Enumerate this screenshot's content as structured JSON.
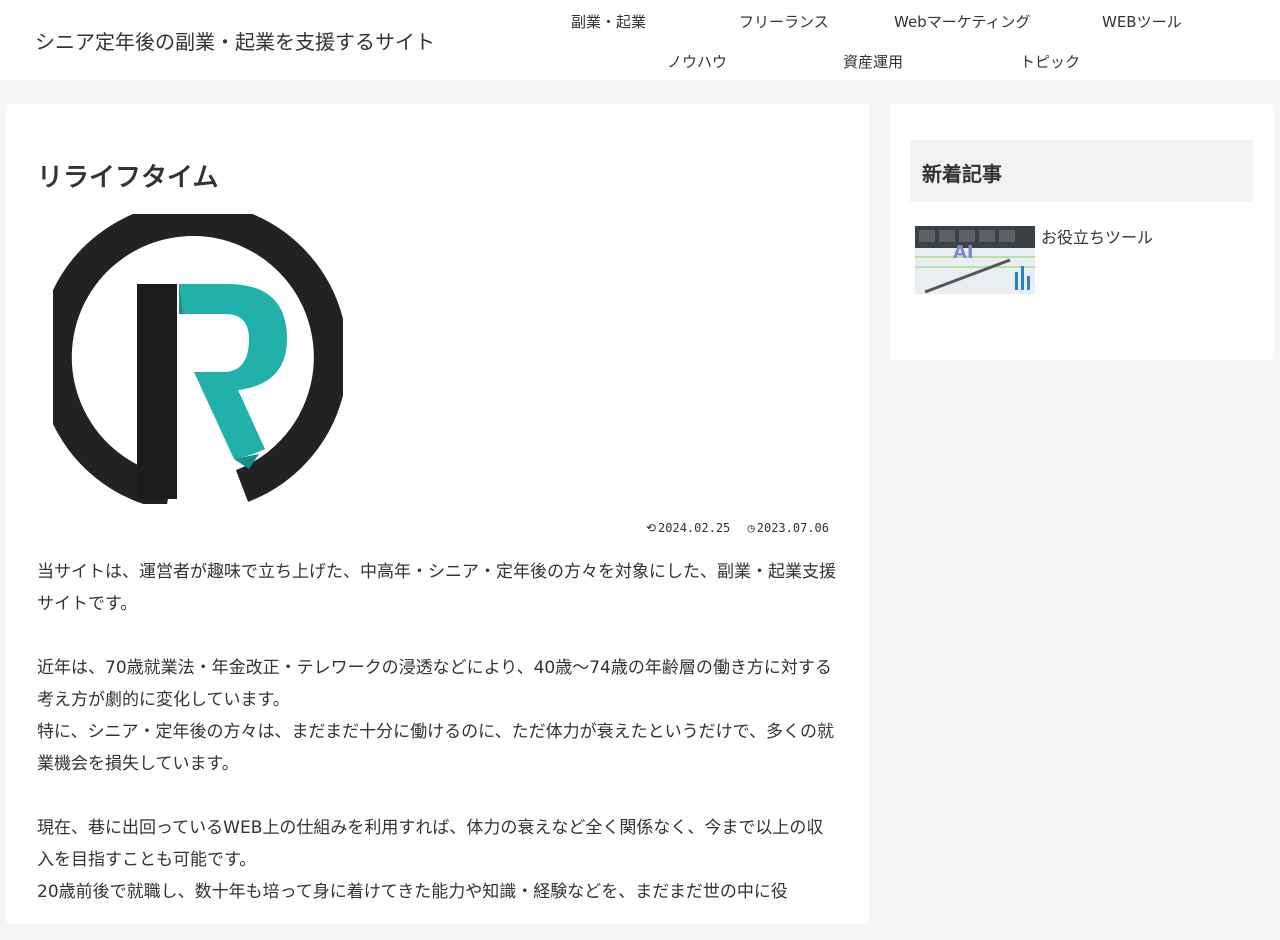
{
  "header": {
    "site_title": "シニア定年後の副業・起業を支援するサイト",
    "nav": [
      {
        "label": "副業・起業"
      },
      {
        "label": "フリーランス"
      },
      {
        "label": "Webマーケティング"
      },
      {
        "label": "WEBツール"
      },
      {
        "label": "ノウハウ"
      },
      {
        "label": "資産運用"
      },
      {
        "label": "トピック"
      }
    ]
  },
  "article": {
    "title": "リライフタイム",
    "updated_date": "2024.02.25",
    "published_date": "2023.07.06",
    "paragraphs": [
      "当サイトは、運営者が趣味で立ち上げた、中高年・シニア・定年後の方々を対象にした、副業・起業支援サイトです。",
      "近年は、70歳就業法・年金改正・テレワークの浸透などにより、40歳〜74歳の年齢層の働き方に対する考え方が劇的に変化しています。\n特に、シニア・定年後の方々は、まだまだ十分に働けるのに、ただ体力が衰えたというだけで、多くの就業機会を損失しています。",
      "現在、巷に出回っているWEB上の仕組みを利用すれば、体力の衰えなど全く関係なく、今まで以上の収入を目指すことも可能です。\n20歳前後で就職し、数十年も培って身に着けてきた能力や知識・経験などを、まだまだ世の中に役"
    ]
  },
  "sidebar": {
    "widget_title": "新着記事",
    "posts": [
      {
        "title": "お役立ちツール",
        "thumb_text": "AI"
      }
    ]
  },
  "colors": {
    "accent_teal": "#20b2aa",
    "logo_dark": "#222222",
    "text": "#333333",
    "page_bg": "#f4f5f7"
  }
}
